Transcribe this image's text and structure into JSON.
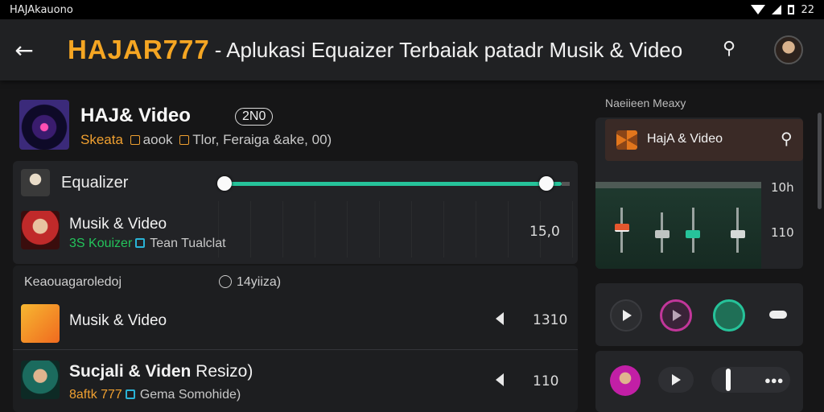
{
  "status_bar": {
    "app_name": "HAJAkauono",
    "battery": "22"
  },
  "app_bar": {
    "brand": "HAJAR777",
    "title": "- Aplukasi Equaizer Terbaiak patadr Musik & Video"
  },
  "hero": {
    "title": "HAJ& Video",
    "badge": "2N0",
    "sub_orange": "Skeata",
    "sub_text1": "aook",
    "sub_text2": "Tlor, Feraiga &ake, 00)"
  },
  "equalizer": {
    "label": "Equalizer",
    "slider_value": 1.0,
    "track_color": "#26c39a"
  },
  "rows": [
    {
      "title": "Musik & Video",
      "sub_green": "3S Kouizer",
      "sub_text": "Tean Tualclat",
      "value": "15,0"
    }
  ],
  "list_section": {
    "header_left": "Keaouagaroledoj",
    "header_right": "14yiiza)"
  },
  "list": [
    {
      "title": "Musik & Video",
      "value": "1310",
      "art_color": "#f5a020"
    },
    {
      "title_bold": "Sucjali & Viden",
      "title_rest": "Resizo)",
      "sub_orange": "8aftk 777",
      "sub_text": "Gema Somohide)",
      "value": "110"
    }
  ],
  "right_panel": {
    "header": "Naeiieen Meaxy",
    "card_title": "HajA & Video",
    "fader_values": [
      "10h",
      "110"
    ],
    "accent": "#26c39a"
  }
}
